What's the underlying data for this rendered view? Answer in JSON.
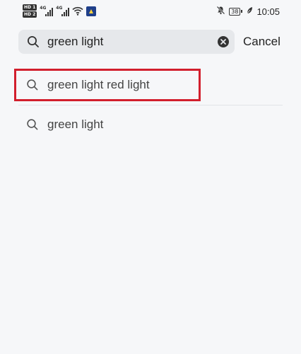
{
  "status_bar": {
    "hd1": "HD 1",
    "hd2": "HD 2",
    "net1": "4G",
    "net2": "4G",
    "battery": "38",
    "time": "10:05",
    "icons": [
      "signal-icon",
      "wifi-icon",
      "mute-icon",
      "battery-icon",
      "leaf-icon"
    ]
  },
  "search": {
    "value": "green light",
    "cancel_label": "Cancel"
  },
  "suggestions": [
    {
      "label": "green light red light"
    },
    {
      "label": "green light"
    }
  ],
  "colors": {
    "background": "#f6f7f9",
    "search_bar": "#e6e8eb",
    "highlight": "#d21f2d"
  }
}
